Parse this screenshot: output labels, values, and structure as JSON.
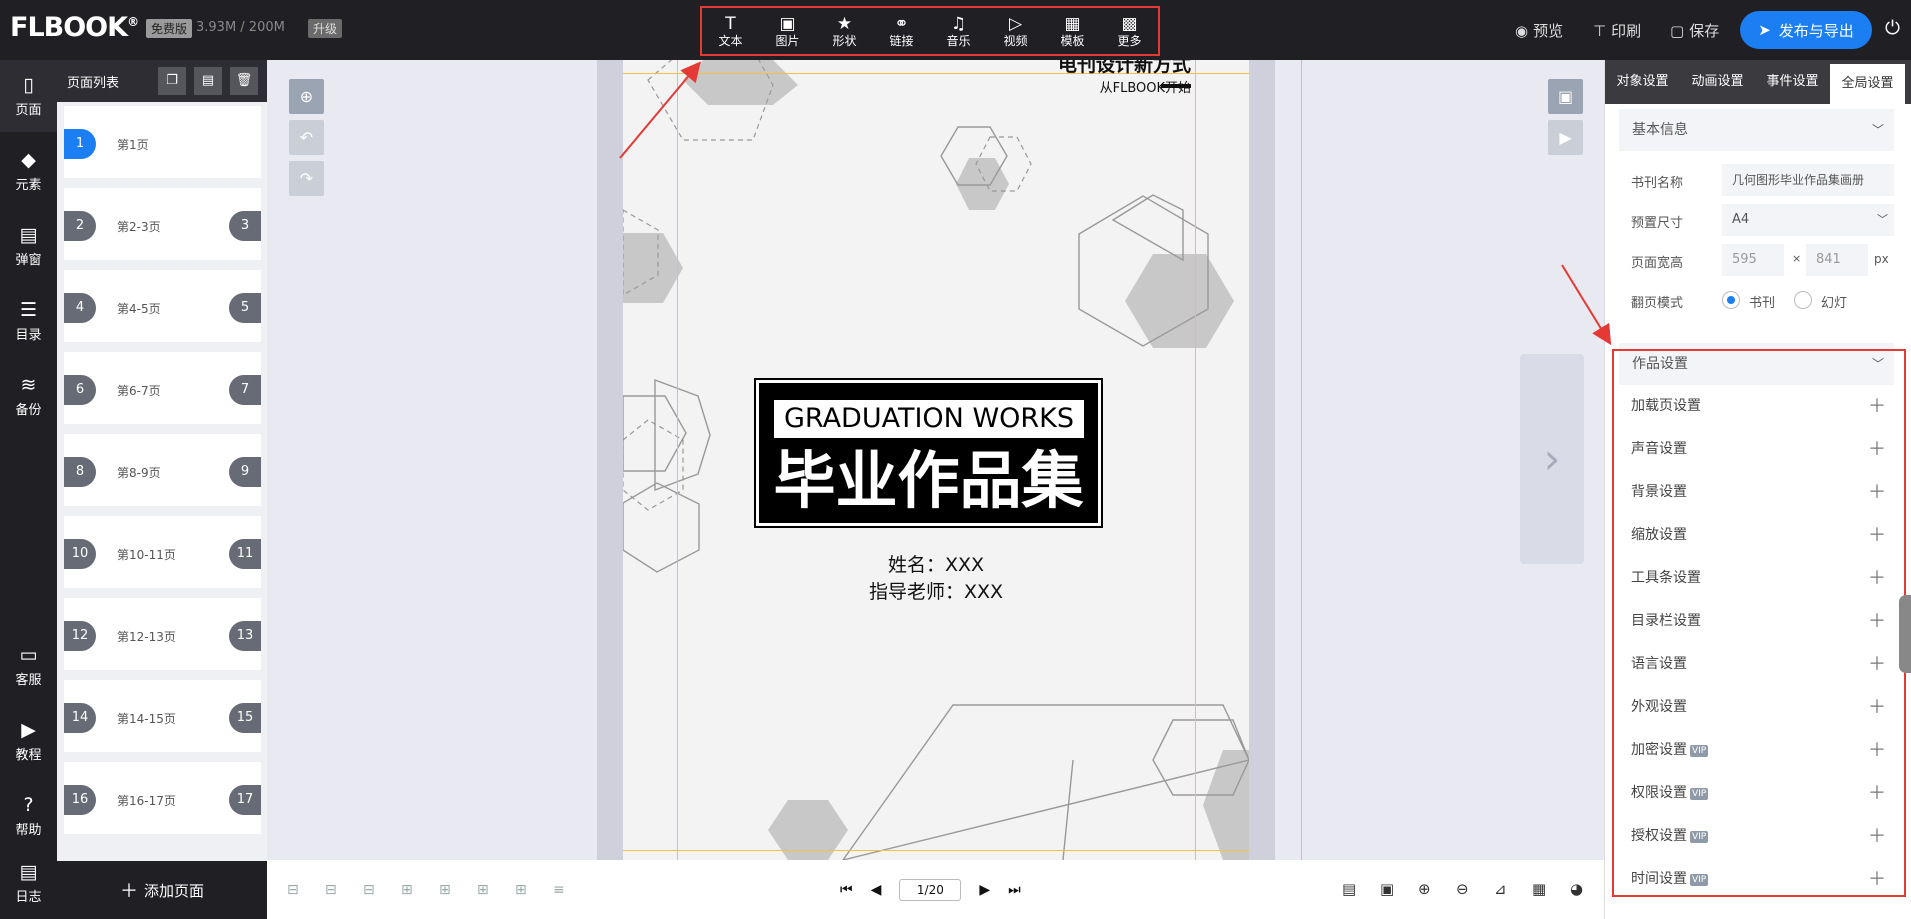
{
  "topbar": {
    "logo": "FLBOOK",
    "logo_mark": "®",
    "edition": "免费版",
    "storage": "3.93M / 200M",
    "upgrade": "升级",
    "tools": [
      {
        "label": "文本",
        "icon": "T"
      },
      {
        "label": "图片",
        "icon": "▣"
      },
      {
        "label": "形状",
        "icon": "★"
      },
      {
        "label": "链接",
        "icon": "⚭"
      },
      {
        "label": "音乐",
        "icon": "♫"
      },
      {
        "label": "视频",
        "icon": "▷"
      },
      {
        "label": "模板",
        "icon": "▦"
      },
      {
        "label": "更多",
        "icon": "▩"
      }
    ],
    "preview": "预览",
    "print": "印刷",
    "save": "保存",
    "publish": "发布与导出"
  },
  "leftnav": [
    {
      "label": "页面",
      "icon": "▯"
    },
    {
      "label": "元素",
      "icon": "◆"
    },
    {
      "label": "弹窗",
      "icon": "▤"
    },
    {
      "label": "目录",
      "icon": "☰"
    },
    {
      "label": "备份",
      "icon": "≋"
    },
    {
      "label": "客服",
      "icon": "▭"
    },
    {
      "label": "教程",
      "icon": "▶"
    },
    {
      "label": "帮助",
      "icon": "?"
    },
    {
      "label": "日志",
      "icon": "▤"
    }
  ],
  "pagelist": {
    "title": "页面列表",
    "pages": [
      {
        "left": "1",
        "label": "第1页",
        "right": ""
      },
      {
        "left": "2",
        "label": "第2-3页",
        "right": "3"
      },
      {
        "left": "4",
        "label": "第4-5页",
        "right": "5"
      },
      {
        "left": "6",
        "label": "第6-7页",
        "right": "7"
      },
      {
        "left": "8",
        "label": "第8-9页",
        "right": "9"
      },
      {
        "left": "10",
        "label": "第10-11页",
        "right": "11"
      },
      {
        "left": "12",
        "label": "第12-13页",
        "right": "13"
      },
      {
        "left": "14",
        "label": "第14-15页",
        "right": "15"
      },
      {
        "left": "16",
        "label": "第16-17页",
        "right": "17"
      }
    ],
    "add_page": "添加页面"
  },
  "canvas": {
    "top_title": "电刊设计新方式",
    "top_sub": "从FLBOOK开始",
    "title_en": "GRADUATION WORKS",
    "title_cn": "毕业作品集",
    "name_line": "姓名：XXX",
    "teacher_line": "指导老师：XXX"
  },
  "pager": {
    "current": "1/20"
  },
  "rightpanel": {
    "tabs": [
      "对象设置",
      "动画设置",
      "事件设置",
      "全局设置"
    ],
    "basic_info": "基本信息",
    "fields": {
      "title_label": "书刊名称",
      "title_value": "几何图形毕业作品集画册",
      "size_label": "预置尺寸",
      "size_value": "A4",
      "dim_label": "页面宽高",
      "width": "595",
      "height": "841",
      "unit": "px",
      "flip_label": "翻页模式",
      "flip_book": "书刊",
      "flip_slide": "幻灯"
    },
    "works_settings": "作品设置",
    "settings": [
      {
        "label": "加载页设置",
        "vip": ""
      },
      {
        "label": "声音设置",
        "vip": ""
      },
      {
        "label": "背景设置",
        "vip": ""
      },
      {
        "label": "缩放设置",
        "vip": ""
      },
      {
        "label": "工具条设置",
        "vip": ""
      },
      {
        "label": "目录栏设置",
        "vip": ""
      },
      {
        "label": "语言设置",
        "vip": ""
      },
      {
        "label": "外观设置",
        "vip": ""
      },
      {
        "label": "加密设置",
        "vip": "VIP"
      },
      {
        "label": "权限设置",
        "vip": "VIP"
      },
      {
        "label": "授权设置",
        "vip": "VIP"
      },
      {
        "label": "时间设置",
        "vip": "VIP"
      }
    ]
  },
  "colors": {
    "accent": "#1b7ef2",
    "highlight": "#e53935",
    "dark": "#1f1f24"
  }
}
